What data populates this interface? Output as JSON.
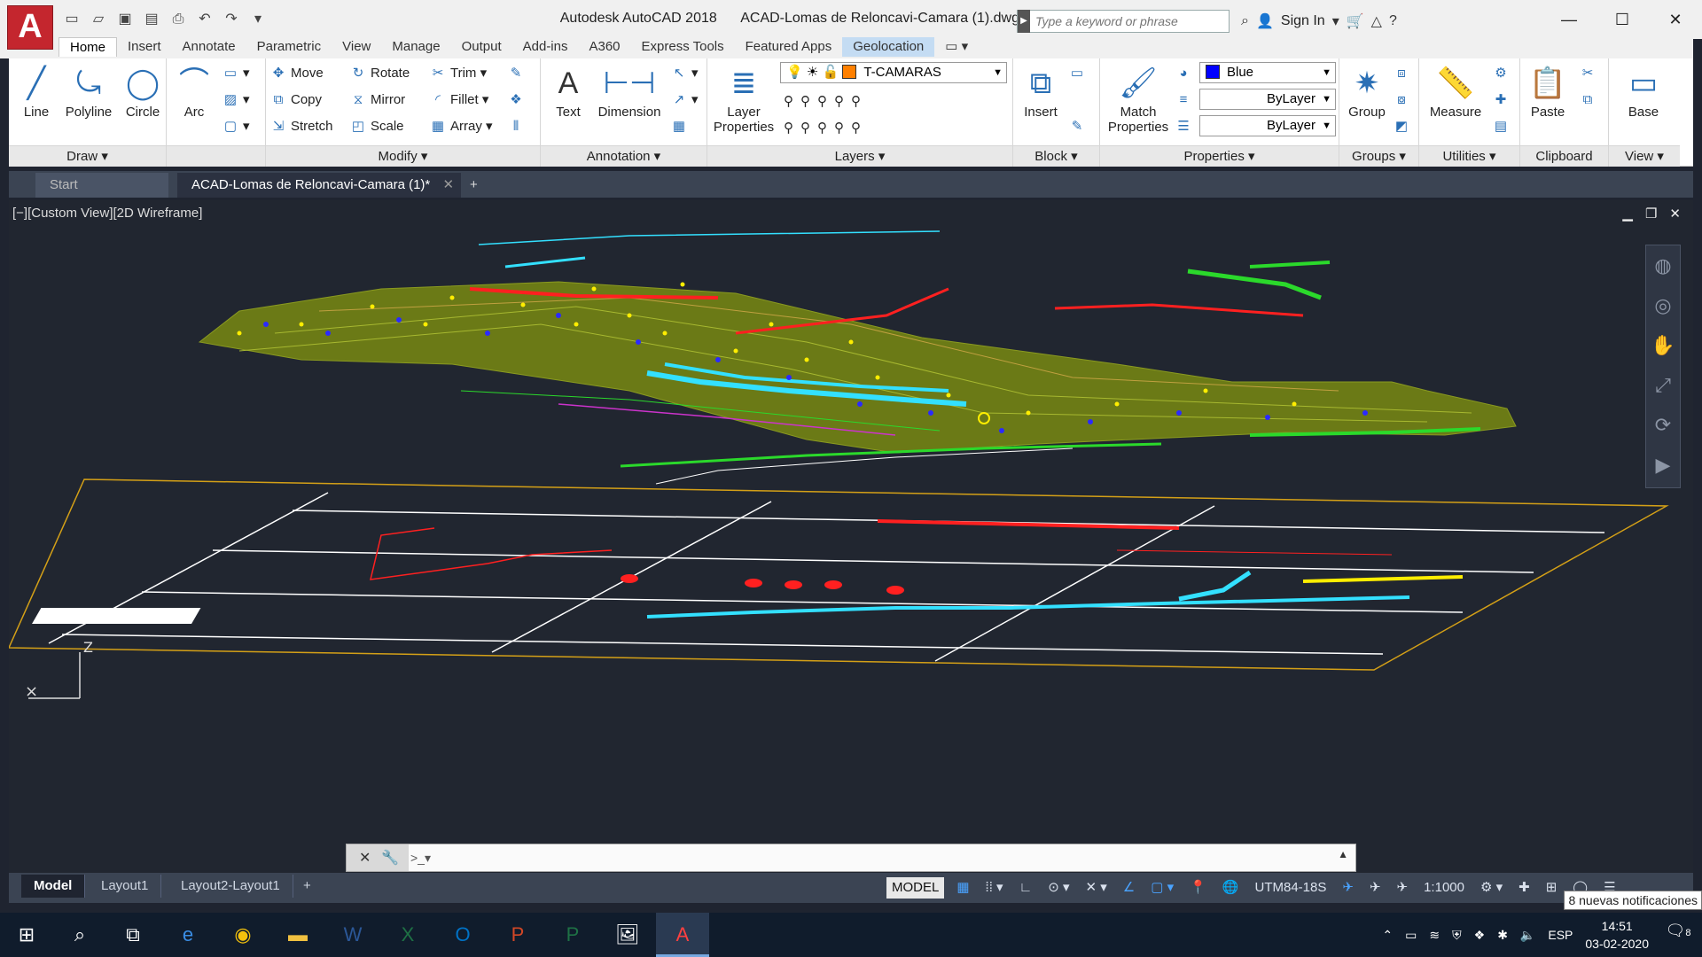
{
  "title": {
    "app": "Autodesk AutoCAD 2018",
    "file": "ACAD-Lomas de Reloncavi-Camara (1).dwg"
  },
  "app_button": "A",
  "search": {
    "placeholder": "Type a keyword or phrase"
  },
  "signin": "Sign In",
  "window_controls": {
    "minimize": "—",
    "maximize": "☐",
    "close": "✕"
  },
  "ribbon_tabs": [
    "Home",
    "Insert",
    "Annotate",
    "Parametric",
    "View",
    "Manage",
    "Output",
    "Add-ins",
    "A360",
    "Express Tools",
    "Featured Apps",
    "Geolocation"
  ],
  "panels": {
    "draw": {
      "title": "Draw",
      "line": "Line",
      "polyline": "Polyline",
      "circle": "Circle",
      "arc": "Arc"
    },
    "modify": {
      "title": "Modify",
      "move": "Move",
      "rotate": "Rotate",
      "trim": "Trim",
      "copy": "Copy",
      "mirror": "Mirror",
      "fillet": "Fillet",
      "stretch": "Stretch",
      "scale": "Scale",
      "array": "Array"
    },
    "annotation": {
      "title": "Annotation",
      "text": "Text",
      "dimension": "Dimension"
    },
    "layers": {
      "title": "Layers",
      "layer_properties": "Layer Properties",
      "current_layer": "T-CAMARAS",
      "layer_color": "#ff8000"
    },
    "block": {
      "title": "Block",
      "insert": "Insert"
    },
    "properties": {
      "title": "Properties",
      "match": "Match Properties",
      "color": "Blue",
      "color_hex": "#0000ff",
      "linetype": "ByLayer",
      "lineweight": "ByLayer"
    },
    "groups": {
      "title": "Groups",
      "group": "Group"
    },
    "utilities": {
      "title": "Utilities",
      "measure": "Measure"
    },
    "clipboard": {
      "title": "Clipboard",
      "paste": "Paste"
    },
    "view": {
      "title": "View",
      "base": "Base"
    }
  },
  "doc_tabs": {
    "start": "Start",
    "file": "ACAD-Lomas de Reloncavi-Camara (1)*",
    "add": "+"
  },
  "viewport": {
    "label": "[−][Custom View][2D Wireframe]"
  },
  "command_line": {
    "value": ""
  },
  "layout_tabs": [
    "Model",
    "Layout1",
    "Layout2-Layout1"
  ],
  "status": {
    "model": "MODEL",
    "coord_system": "UTM84-18S",
    "scale": "1:1000"
  },
  "notification": "8 nuevas notificaciones",
  "taskbar": {
    "language": "ESP",
    "time": "14:51",
    "date": "03-02-2020",
    "notifications_count": "8"
  }
}
